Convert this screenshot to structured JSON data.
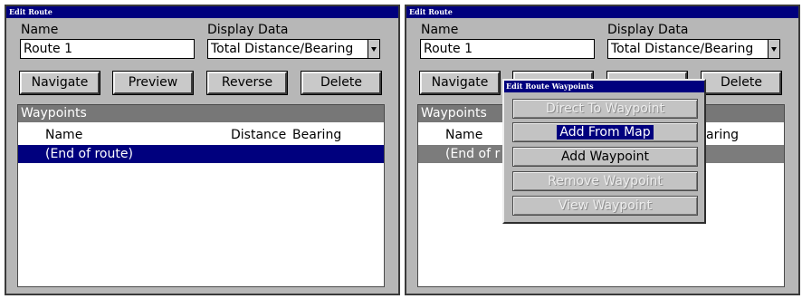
{
  "left": {
    "title": "Edit Route",
    "name_label": "Name",
    "name_value": "Route 1",
    "display_label": "Display Data",
    "display_value": "Total Distance/Bearing",
    "buttons": [
      "Navigate",
      "Preview",
      "Reverse",
      "Delete"
    ],
    "waypoints": {
      "header": "Waypoints",
      "columns": [
        "Name",
        "Distance",
        "Bearing"
      ],
      "rows": [
        "(End of route)"
      ]
    }
  },
  "right": {
    "title": "Edit Route",
    "name_label": "Name",
    "name_value": "Route 1",
    "display_label": "Display Data",
    "display_value": "Total Distance/Bearing",
    "buttons": [
      "Navigate",
      "Delete"
    ],
    "waypoints": {
      "header": "Waypoints",
      "columns": [
        "Name",
        "aring"
      ],
      "rows": [
        "(End of r"
      ]
    },
    "menu": {
      "title": "Edit Route Waypoints",
      "items": [
        {
          "label": "Direct To Waypoint",
          "enabled": false
        },
        {
          "label": "Add From Map",
          "enabled": true,
          "highlighted": true
        },
        {
          "label": "Add Waypoint",
          "enabled": true
        },
        {
          "label": "Remove Waypoint",
          "enabled": false
        },
        {
          "label": "View Waypoint",
          "enabled": false
        }
      ]
    }
  },
  "colors": {
    "titlebar": "#00007e",
    "panel": "#b7b7b7",
    "selection": "#00007e",
    "list_header": "#777777"
  }
}
